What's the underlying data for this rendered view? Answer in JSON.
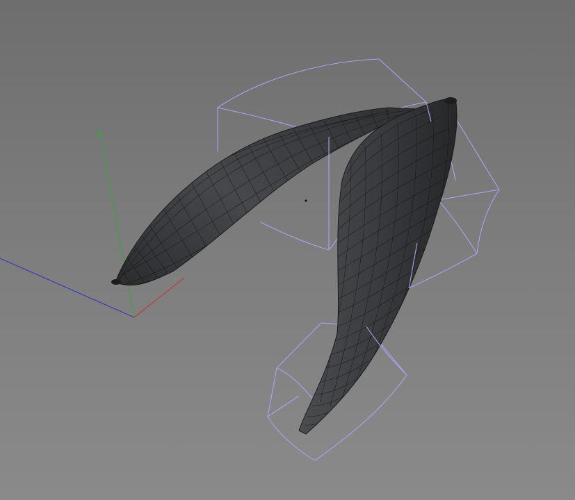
{
  "viewport": {
    "background_top": "#6e6e6e",
    "background_bottom": "#8a8a8a"
  },
  "axes": {
    "y_axis_color": "#3fa23f",
    "x_axis_color": "#c03a3a",
    "z_axis_color": "#3b3bb8"
  },
  "objects": [
    {
      "name": "banana-left",
      "material_color": "#3a3b3d"
    },
    {
      "name": "banana-right",
      "material_color": "#3a3b3d"
    }
  ],
  "deformer_cage_color": "#a9a2f2"
}
